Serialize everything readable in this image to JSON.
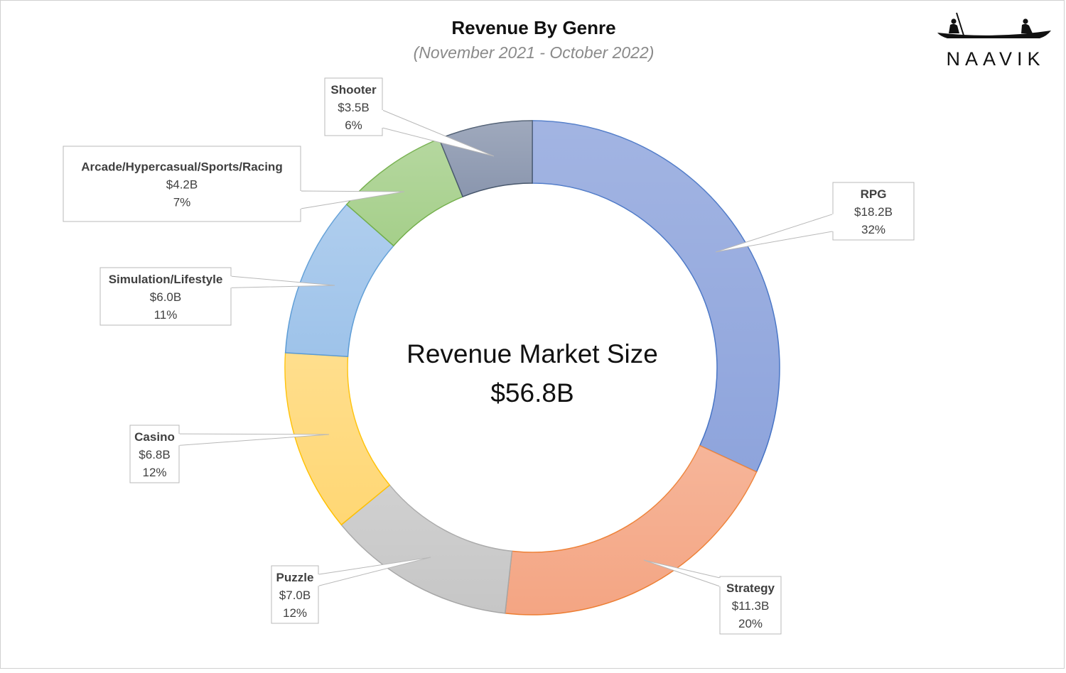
{
  "chart_data": {
    "type": "donut",
    "title": "Revenue By Genre",
    "subtitle": "(November 2021 - October 2022)",
    "center_label": "Revenue Market Size",
    "center_value": "$56.8B",
    "total": 56.8,
    "unit": "$B",
    "legend": "none",
    "slices": [
      {
        "name": "RPG",
        "value": 18.2,
        "value_label": "$18.2B",
        "percent_label": "32%",
        "color": "#8ea4dc",
        "edge": "#4472c4"
      },
      {
        "name": "Strategy",
        "value": 11.3,
        "value_label": "$11.3B",
        "percent_label": "20%",
        "color": "#f4a583",
        "edge": "#ed7d31"
      },
      {
        "name": "Puzzle",
        "value": 7.0,
        "value_label": "$7.0B",
        "percent_label": "12%",
        "color": "#c6c6c6",
        "edge": "#a5a5a5"
      },
      {
        "name": "Casino",
        "value": 6.8,
        "value_label": "$6.8B",
        "percent_label": "12%",
        "color": "#ffd774",
        "edge": "#ffc000"
      },
      {
        "name": "Simulation/Lifestyle",
        "value": 6.0,
        "value_label": "$6.0B",
        "percent_label": "11%",
        "color": "#9ec3ea",
        "edge": "#5b9bd5"
      },
      {
        "name": "Arcade/Hypercasual/Sports/Racing",
        "value": 4.2,
        "value_label": "$4.2B",
        "percent_label": "7%",
        "color": "#a5cf8a",
        "edge": "#70ad47"
      },
      {
        "name": "Shooter",
        "value": 3.5,
        "value_label": "$3.5B",
        "percent_label": "6%",
        "color": "#8a96ae",
        "edge": "#44546a"
      }
    ]
  },
  "brand": {
    "name": "NAAVIK"
  }
}
